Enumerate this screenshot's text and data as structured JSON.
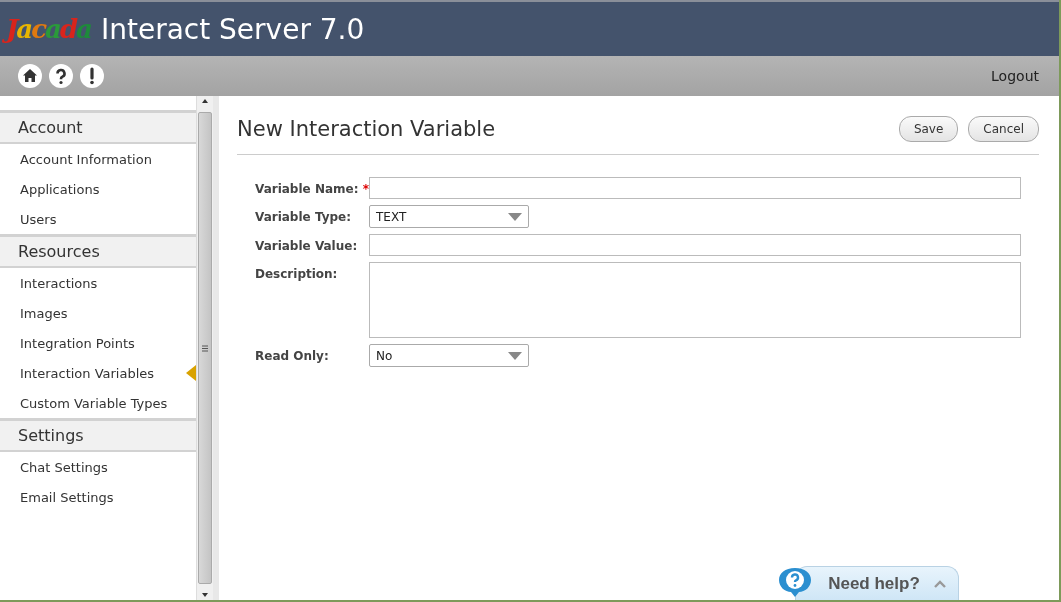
{
  "header": {
    "logo": "Jacada",
    "title": "Interact Server 7.0"
  },
  "toolbar": {
    "logout": "Logout"
  },
  "sidebar": {
    "sections": [
      {
        "title": "Account",
        "items": [
          {
            "label": "Account Information",
            "selected": false
          },
          {
            "label": "Applications",
            "selected": false
          },
          {
            "label": "Users",
            "selected": false
          }
        ]
      },
      {
        "title": "Resources",
        "items": [
          {
            "label": "Interactions",
            "selected": false
          },
          {
            "label": "Images",
            "selected": false
          },
          {
            "label": "Integration Points",
            "selected": false
          },
          {
            "label": "Interaction Variables",
            "selected": true
          },
          {
            "label": "Custom Variable Types",
            "selected": false
          }
        ]
      },
      {
        "title": "Settings",
        "items": [
          {
            "label": "Chat Settings",
            "selected": false
          },
          {
            "label": "Email Settings",
            "selected": false
          }
        ]
      }
    ]
  },
  "page": {
    "title": "New Interaction Variable",
    "buttons": [
      "Save",
      "Cancel"
    ]
  },
  "form": {
    "fields": [
      {
        "kind": "text",
        "label": "Variable Name:",
        "required_mark": "*"
      },
      {
        "kind": "select",
        "label": "Variable Type:",
        "value": "TEXT"
      },
      {
        "kind": "text",
        "label": "Variable Value:"
      },
      {
        "kind": "textarea",
        "label": "Description:"
      },
      {
        "kind": "select",
        "label": "Read Only:",
        "value": "No"
      }
    ]
  },
  "help": {
    "label": "Need help?"
  }
}
